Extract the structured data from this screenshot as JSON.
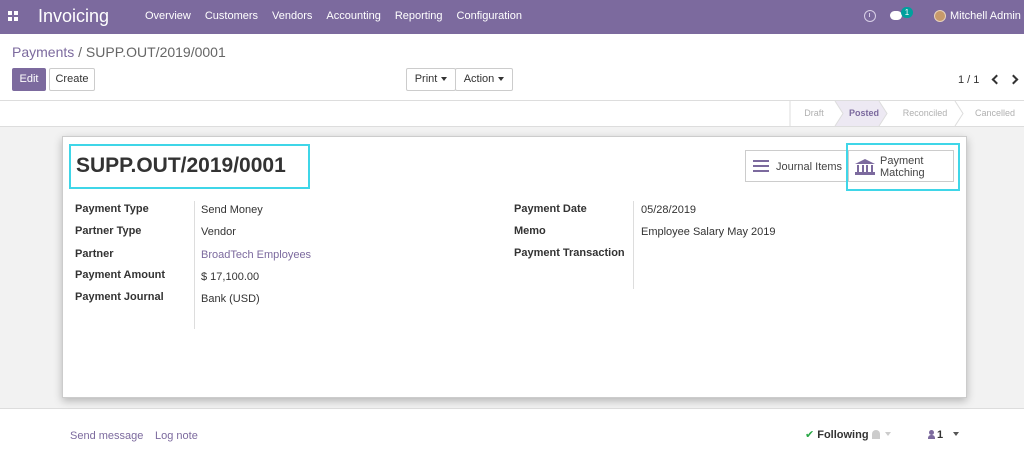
{
  "navbar": {
    "app_name": "Invoicing",
    "menu": [
      "Overview",
      "Customers",
      "Vendors",
      "Accounting",
      "Reporting",
      "Configuration"
    ],
    "message_count": "1",
    "user_name": "Mitchell Admin",
    "accent_color": "#7c6a9e"
  },
  "breadcrumb": {
    "parent": "Payments",
    "separator": "/",
    "current": "SUPP.OUT/2019/0001"
  },
  "buttons": {
    "edit": "Edit",
    "create": "Create",
    "print": "Print",
    "action": "Action"
  },
  "pager": {
    "value": "1 / 1"
  },
  "statusbar": {
    "stages": [
      "Draft",
      "Posted",
      "Reconciled",
      "Cancelled"
    ],
    "active": "Posted"
  },
  "record": {
    "title": "SUPP.OUT/2019/0001",
    "smart_buttons": {
      "journal_items": "Journal Items",
      "payment_matching_line1": "Payment",
      "payment_matching_line2": "Matching"
    },
    "left_fields": [
      {
        "label": "Payment Type",
        "value": "Send Money"
      },
      {
        "label": "Partner Type",
        "value": "Vendor"
      },
      {
        "label": "Partner",
        "value": "BroadTech Employees"
      },
      {
        "label": "Payment Amount",
        "value": "$ 17,100.00"
      },
      {
        "label": "Payment Journal",
        "value": "Bank (USD)"
      }
    ],
    "right_fields": [
      {
        "label": "Payment Date",
        "value": "05/28/2019"
      },
      {
        "label": "Memo",
        "value": "Employee Salary May 2019"
      },
      {
        "label": "Payment Transaction",
        "value": ""
      }
    ]
  },
  "chatter": {
    "send_message": "Send message",
    "log_note": "Log note",
    "following": "Following",
    "followers_count": "1"
  },
  "icons": [
    "apps-grid-icon",
    "activity-clock-icon",
    "chat-bubble-icon",
    "user-avatar",
    "chevron-left-icon",
    "chevron-right-icon",
    "list-icon",
    "bank-icon",
    "check-icon",
    "bell-icon",
    "user-icon"
  ]
}
